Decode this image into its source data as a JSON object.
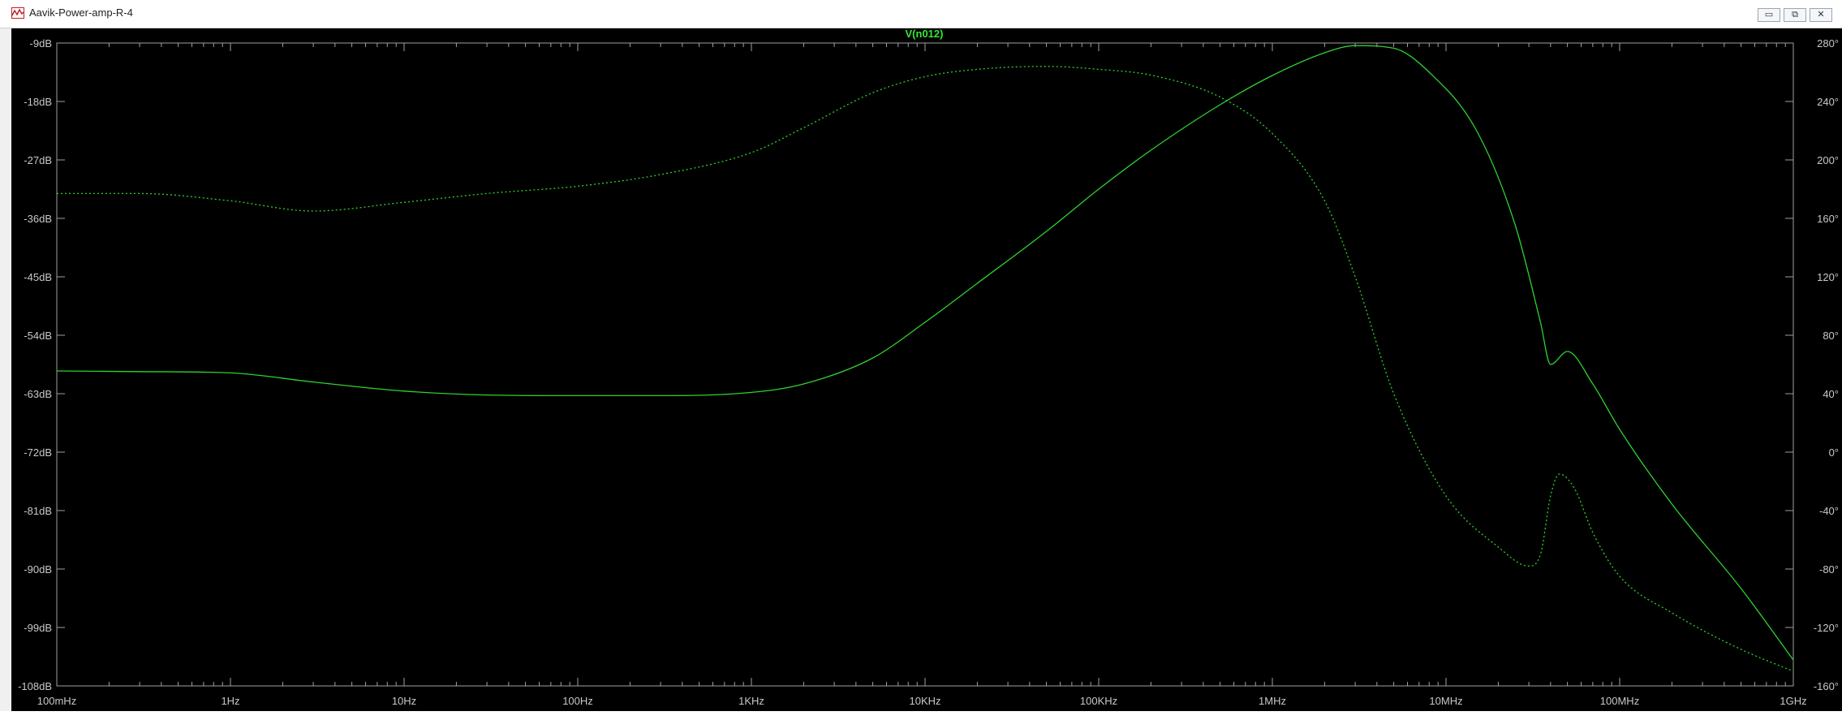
{
  "window": {
    "title": "Aavik-Power-amp-R-4",
    "buttons": {
      "minimize": "▭",
      "restore": "⧉",
      "close": "✕"
    }
  },
  "colors": {
    "background": "#000000",
    "trace": "#2fd12f",
    "title": "#34e834",
    "tick_label": "#c8c8c8",
    "frame": "#a0a0a0"
  },
  "chart_data": {
    "type": "line",
    "title": "V(n012)",
    "xscale": "log",
    "xlim_hz": [
      0.1,
      1000000000
    ],
    "x_ticks": [
      {
        "value": 0.1,
        "label": "100mHz"
      },
      {
        "value": 1,
        "label": "1Hz"
      },
      {
        "value": 10,
        "label": "10Hz"
      },
      {
        "value": 100,
        "label": "100Hz"
      },
      {
        "value": 1000,
        "label": "1KHz"
      },
      {
        "value": 10000,
        "label": "10KHz"
      },
      {
        "value": 100000,
        "label": "100KHz"
      },
      {
        "value": 1000000,
        "label": "1MHz"
      },
      {
        "value": 10000000,
        "label": "10MHz"
      },
      {
        "value": 100000000,
        "label": "100MHz"
      },
      {
        "value": 1000000000,
        "label": "1GHz"
      }
    ],
    "y_left": {
      "unit": "dB",
      "ylim": [
        -108,
        -9
      ],
      "ticks": [
        "-9dB",
        "-18dB",
        "-27dB",
        "-36dB",
        "-45dB",
        "-54dB",
        "-63dB",
        "-72dB",
        "-81dB",
        "-90dB",
        "-99dB",
        "-108dB"
      ]
    },
    "y_right": {
      "unit": "degrees",
      "ylim": [
        -160,
        280
      ],
      "ticks": [
        "280°",
        "240°",
        "200°",
        "160°",
        "120°",
        "80°",
        "40°",
        "0°",
        "-40°",
        "-80°",
        "-120°",
        "-160°"
      ]
    },
    "series": [
      {
        "name": "V(n012)",
        "quantity": "magnitude",
        "axis": "left",
        "style": "solid",
        "x": [
          0.1,
          0.3,
          1,
          3,
          10,
          30,
          100,
          300,
          1000,
          2000,
          5000,
          10000,
          20000,
          50000,
          100000,
          200000,
          500000,
          1000000,
          2000000,
          3000000,
          5000000,
          8000000,
          15000000,
          25000000,
          35000000,
          40000000,
          50000000,
          70000000,
          100000000,
          200000000,
          500000000,
          1000000000
        ],
        "values": [
          -59.5,
          -59.6,
          -59.8,
          -61.2,
          -62.6,
          -63.2,
          -63.3,
          -63.3,
          -62.8,
          -61.5,
          -57.5,
          -52,
          -46,
          -38,
          -31.5,
          -25.5,
          -18.5,
          -14,
          -10.5,
          -9.4,
          -9.8,
          -13.5,
          -22.5,
          -37,
          -52,
          -58.5,
          -56.5,
          -61.5,
          -68.5,
          -80,
          -93,
          -104
        ]
      },
      {
        "name": "V(n012)",
        "quantity": "phase",
        "axis": "right",
        "style": "dotted",
        "x": [
          0.1,
          0.3,
          1,
          3,
          10,
          30,
          100,
          300,
          1000,
          2000,
          5000,
          10000,
          20000,
          50000,
          100000,
          200000,
          500000,
          1000000,
          2000000,
          3000000,
          5000000,
          10000000,
          20000000,
          30000000,
          35000000,
          40000000,
          45000000,
          55000000,
          70000000,
          100000000,
          200000000,
          500000000,
          1000000000
        ],
        "values": [
          177,
          177,
          172,
          165,
          171,
          177,
          182,
          190,
          205,
          222,
          246,
          257,
          262,
          264,
          262,
          258,
          243,
          218,
          172,
          120,
          40,
          -30,
          -65,
          -78,
          -70,
          -30,
          -15,
          -25,
          -55,
          -85,
          -110,
          -135,
          -150
        ]
      }
    ]
  }
}
